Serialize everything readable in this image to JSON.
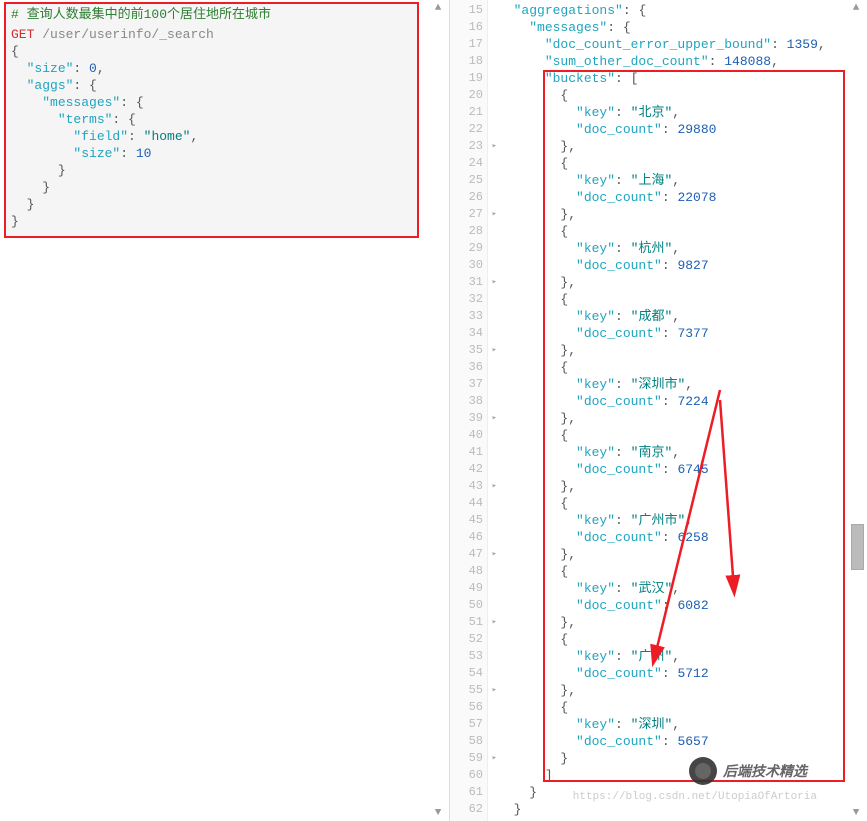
{
  "leftEditor": {
    "comment": "# 查询人数最集中的前100个居住地所在城市",
    "method": "GET",
    "path": "/user/userinfo/_search",
    "body": [
      {
        "indent": 0,
        "text": "{"
      },
      {
        "indent": 1,
        "prop": "\"size\"",
        "sep": ": ",
        "val": "0",
        "comma": ","
      },
      {
        "indent": 1,
        "prop": "\"aggs\"",
        "sep": ": ",
        "val": "{",
        "comma": ""
      },
      {
        "indent": 2,
        "prop": "\"messages\"",
        "sep": ": ",
        "val": "{",
        "comma": ""
      },
      {
        "indent": 3,
        "prop": "\"terms\"",
        "sep": ": ",
        "val": "{",
        "comma": ""
      },
      {
        "indent": 4,
        "prop": "\"field\"",
        "sep": ": ",
        "valstr": "\"home\"",
        "comma": ","
      },
      {
        "indent": 4,
        "prop": "\"size\"",
        "sep": ": ",
        "val": "10",
        "comma": ""
      },
      {
        "indent": 3,
        "text": "}"
      },
      {
        "indent": 2,
        "text": "}"
      },
      {
        "indent": 1,
        "text": "}"
      },
      {
        "indent": 0,
        "text": "}"
      }
    ]
  },
  "rightGutter": {
    "start": 15,
    "end": 62,
    "folds": [
      23,
      27,
      31,
      35,
      39,
      43,
      47,
      51,
      55,
      59
    ]
  },
  "rightLines": [
    {
      "n": 15,
      "i": 1,
      "prop": "\"aggregations\"",
      "sep": ": ",
      "raw": "{"
    },
    {
      "n": 16,
      "i": 2,
      "prop": "\"messages\"",
      "sep": ": ",
      "raw": "{"
    },
    {
      "n": 17,
      "i": 3,
      "prop": "\"doc_count_error_upper_bound\"",
      "sep": ": ",
      "num": "1359",
      "comma": ","
    },
    {
      "n": 18,
      "i": 3,
      "prop": "\"sum_other_doc_count\"",
      "sep": ": ",
      "num": "148088",
      "comma": ","
    },
    {
      "n": 19,
      "i": 3,
      "prop": "\"buckets\"",
      "sep": ": ",
      "raw": "["
    },
    {
      "n": 20,
      "i": 4,
      "raw": "{"
    },
    {
      "n": 21,
      "i": 5,
      "prop": "\"key\"",
      "sep": ": ",
      "str": "\"北京\"",
      "comma": ","
    },
    {
      "n": 22,
      "i": 5,
      "prop": "\"doc_count\"",
      "sep": ": ",
      "num": "29880"
    },
    {
      "n": 23,
      "i": 4,
      "raw": "},"
    },
    {
      "n": 24,
      "i": 4,
      "raw": "{"
    },
    {
      "n": 25,
      "i": 5,
      "prop": "\"key\"",
      "sep": ": ",
      "str": "\"上海\"",
      "comma": ","
    },
    {
      "n": 26,
      "i": 5,
      "prop": "\"doc_count\"",
      "sep": ": ",
      "num": "22078"
    },
    {
      "n": 27,
      "i": 4,
      "raw": "},"
    },
    {
      "n": 28,
      "i": 4,
      "raw": "{"
    },
    {
      "n": 29,
      "i": 5,
      "prop": "\"key\"",
      "sep": ": ",
      "str": "\"杭州\"",
      "comma": ","
    },
    {
      "n": 30,
      "i": 5,
      "prop": "\"doc_count\"",
      "sep": ": ",
      "num": "9827"
    },
    {
      "n": 31,
      "i": 4,
      "raw": "},"
    },
    {
      "n": 32,
      "i": 4,
      "raw": "{"
    },
    {
      "n": 33,
      "i": 5,
      "prop": "\"key\"",
      "sep": ": ",
      "str": "\"成都\"",
      "comma": ","
    },
    {
      "n": 34,
      "i": 5,
      "prop": "\"doc_count\"",
      "sep": ": ",
      "num": "7377"
    },
    {
      "n": 35,
      "i": 4,
      "raw": "},"
    },
    {
      "n": 36,
      "i": 4,
      "raw": "{"
    },
    {
      "n": 37,
      "i": 5,
      "prop": "\"key\"",
      "sep": ": ",
      "str": "\"深圳市\"",
      "comma": ","
    },
    {
      "n": 38,
      "i": 5,
      "prop": "\"doc_count\"",
      "sep": ": ",
      "num": "7224"
    },
    {
      "n": 39,
      "i": 4,
      "raw": "},"
    },
    {
      "n": 40,
      "i": 4,
      "raw": "{"
    },
    {
      "n": 41,
      "i": 5,
      "prop": "\"key\"",
      "sep": ": ",
      "str": "\"南京\"",
      "comma": ","
    },
    {
      "n": 42,
      "i": 5,
      "prop": "\"doc_count\"",
      "sep": ": ",
      "num": "6745"
    },
    {
      "n": 43,
      "i": 4,
      "raw": "},"
    },
    {
      "n": 44,
      "i": 4,
      "raw": "{"
    },
    {
      "n": 45,
      "i": 5,
      "prop": "\"key\"",
      "sep": ": ",
      "str": "\"广州市\"",
      "comma": ","
    },
    {
      "n": 46,
      "i": 5,
      "prop": "\"doc_count\"",
      "sep": ": ",
      "num": "6258"
    },
    {
      "n": 47,
      "i": 4,
      "raw": "},"
    },
    {
      "n": 48,
      "i": 4,
      "raw": "{"
    },
    {
      "n": 49,
      "i": 5,
      "prop": "\"key\"",
      "sep": ": ",
      "str": "\"武汉\"",
      "comma": ","
    },
    {
      "n": 50,
      "i": 5,
      "prop": "\"doc_count\"",
      "sep": ": ",
      "num": "6082"
    },
    {
      "n": 51,
      "i": 4,
      "raw": "},"
    },
    {
      "n": 52,
      "i": 4,
      "raw": "{"
    },
    {
      "n": 53,
      "i": 5,
      "prop": "\"key\"",
      "sep": ": ",
      "str": "\"广州\"",
      "comma": ","
    },
    {
      "n": 54,
      "i": 5,
      "prop": "\"doc_count\"",
      "sep": ": ",
      "num": "5712"
    },
    {
      "n": 55,
      "i": 4,
      "raw": "},"
    },
    {
      "n": 56,
      "i": 4,
      "raw": "{"
    },
    {
      "n": 57,
      "i": 5,
      "prop": "\"key\"",
      "sep": ": ",
      "str": "\"深圳\"",
      "comma": ","
    },
    {
      "n": 58,
      "i": 5,
      "prop": "\"doc_count\"",
      "sep": ": ",
      "num": "5657"
    },
    {
      "n": 59,
      "i": 4,
      "raw": "}"
    },
    {
      "n": 60,
      "i": 3,
      "raw": "]"
    },
    {
      "n": 61,
      "i": 2,
      "raw": "}"
    },
    {
      "n": 62,
      "i": 1,
      "raw": "}"
    }
  ],
  "watermark": {
    "text": "后端技术精选",
    "url": "https://blog.csdn.net/UtopiaOfArtoria"
  },
  "icons": {
    "run": "▶",
    "wrench": "🔧",
    "up": "▲",
    "down": "▼",
    "fold": "▸"
  }
}
